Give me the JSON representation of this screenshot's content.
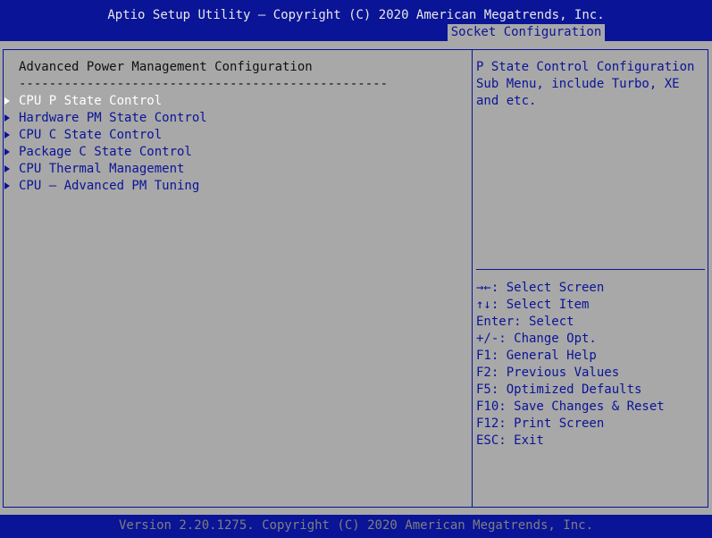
{
  "header": {
    "title": "Aptio Setup Utility – Copyright (C) 2020 American Megatrends, Inc.",
    "active_tab": "Socket Configuration"
  },
  "main": {
    "section_title": "Advanced Power Management Configuration",
    "separator": "-------------------------------------------------",
    "menu_items": [
      {
        "label": "CPU P State Control",
        "selected": true
      },
      {
        "label": "Hardware PM State Control",
        "selected": false
      },
      {
        "label": "CPU C State Control",
        "selected": false
      },
      {
        "label": "Package C State Control",
        "selected": false
      },
      {
        "label": "CPU Thermal Management",
        "selected": false
      },
      {
        "label": "CPU – Advanced PM Tuning",
        "selected": false
      }
    ]
  },
  "help": {
    "lines": [
      "P State Control Configuration",
      "Sub Menu, include Turbo, XE",
      "and etc."
    ]
  },
  "keys": [
    "→←: Select Screen",
    "↑↓: Select Item",
    "Enter: Select",
    "+/-: Change Opt.",
    "F1: General Help",
    "F2: Previous Values",
    "F5: Optimized Defaults",
    "F10: Save Changes & Reset",
    "F12: Print Screen",
    "ESC: Exit"
  ],
  "footer": {
    "version": "Version 2.20.1275. Copyright (C) 2020 American Megatrends, Inc."
  },
  "colors": {
    "bios_blue": "#0a1496",
    "panel_gray": "#a8a8a8",
    "selected_text": "#ffffff",
    "footer_text": "#7f7f7f"
  }
}
